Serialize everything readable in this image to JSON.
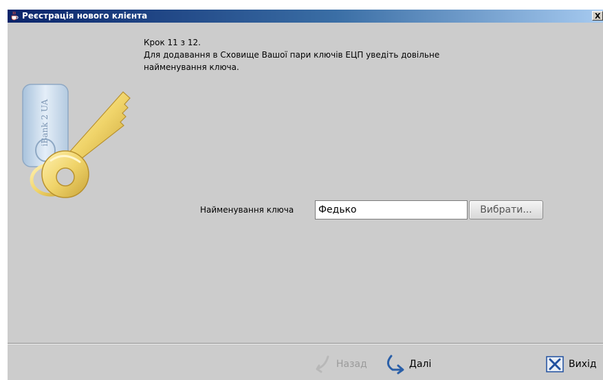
{
  "window": {
    "title": "Реєстрація нового клієнта",
    "close_label": "X"
  },
  "instruction": {
    "line1": "Крок 11 з 12.",
    "line2": "Для додавання в Сховище Вашої пари ключів ЕЦП уведіть довільне",
    "line3": "найменування ключа."
  },
  "illustration": {
    "token_text": "iBank 2 UA"
  },
  "form": {
    "key_name_label": "Найменування ключа",
    "key_name_value": "Федько",
    "choose_button": "Вибрати..."
  },
  "footer": {
    "back_label": "Назад",
    "next_label": "Далі",
    "exit_label": "Вихід"
  },
  "colors": {
    "window_bg": "#cccccc",
    "titlebar_start": "#0a246a",
    "titlebar_end": "#a6caf0",
    "next_arrow": "#2a5fa8",
    "exit_icon": "#1f4f9f",
    "key_gold": "#e8c85a"
  },
  "icons": {
    "title": "java-cup-icon",
    "back": "back-arrow-icon",
    "next": "next-arrow-icon",
    "exit": "exit-x-icon",
    "illustration": "key-with-token-illustration"
  }
}
